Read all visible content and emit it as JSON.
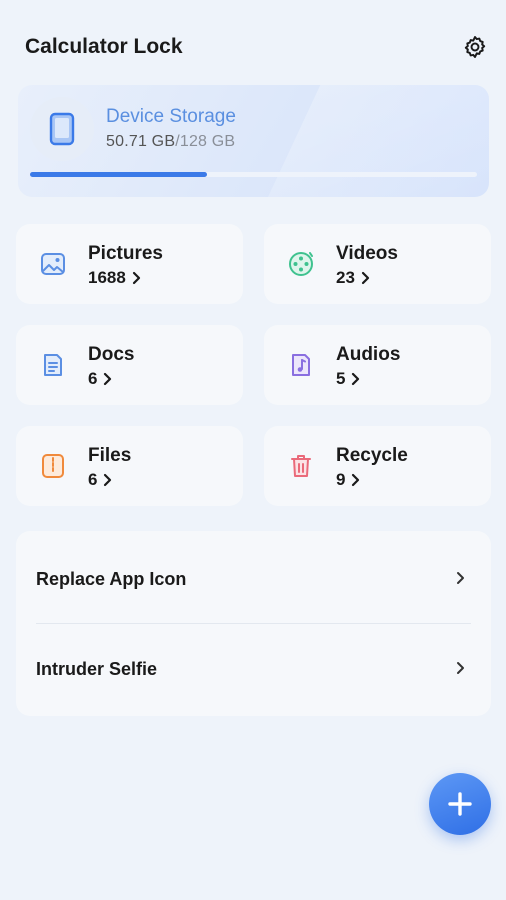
{
  "header": {
    "title": "Calculator Lock",
    "settings_icon": "gear-icon"
  },
  "storage": {
    "label": "Device Storage",
    "used": "50.71 GB",
    "total": "/128 GB",
    "used_fraction": 0.396,
    "icon": "phone-icon",
    "accent": "#3b7ae8"
  },
  "categories": [
    {
      "name": "Pictures",
      "count": "1688",
      "icon": "image-icon",
      "color": "#5b8fe3"
    },
    {
      "name": "Videos",
      "count": "23",
      "icon": "film-reel-icon",
      "color": "#3fc28f"
    },
    {
      "name": "Docs",
      "count": "6",
      "icon": "document-icon",
      "color": "#5b8fe3"
    },
    {
      "name": "Audios",
      "count": "5",
      "icon": "music-note-icon",
      "color": "#8a6fe0"
    },
    {
      "name": "Files",
      "count": "6",
      "icon": "zip-file-icon",
      "color": "#f08a3c"
    },
    {
      "name": "Recycle",
      "count": "9",
      "icon": "trash-icon",
      "color": "#ea6a7a"
    }
  ],
  "menu": {
    "items": [
      {
        "label": "Replace App Icon"
      },
      {
        "label": "Intruder Selfie"
      }
    ]
  },
  "fab": {
    "icon": "plus-icon",
    "color": "#3b7ae8"
  }
}
